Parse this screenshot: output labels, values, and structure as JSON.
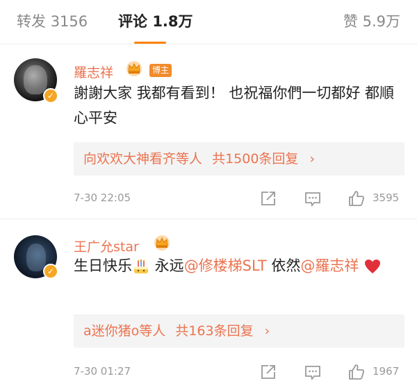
{
  "tabs": {
    "repost": {
      "label": "转发",
      "count": "3156"
    },
    "comments": {
      "label": "评论",
      "count": "1.8万"
    },
    "likes": {
      "label": "赞",
      "count": "5.9万"
    }
  },
  "colors": {
    "accent": "#eb7350",
    "underline": "#ff8200",
    "badge": "#f28b2c"
  },
  "comments": [
    {
      "username": "羅志祥",
      "badge": "博主",
      "text": "謝謝大家 我都有看到！ 也祝福你們一切都好 都順心平安",
      "replies": {
        "users": "向欢欢大神看齐等人",
        "total": "共1500条回复"
      },
      "time": "7-30 22:05",
      "likes": "3595"
    },
    {
      "username": "王广允star",
      "text_parts": {
        "before": "生日快乐",
        "middle": " 永远",
        "mention1": "@修楼梯SLT",
        "between": " 依然",
        "mention2": "@羅志祥"
      },
      "replies": {
        "users": "a迷你猪o等人",
        "total": "共163条回复"
      },
      "time": "7-30 01:27",
      "likes": "1967"
    }
  ]
}
